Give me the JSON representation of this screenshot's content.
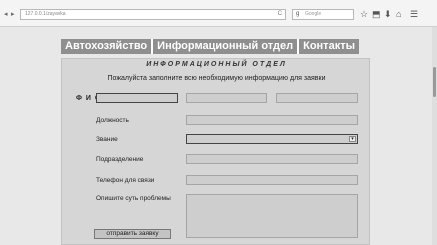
{
  "browser": {
    "nav_back": "◂",
    "nav_forward": "▸",
    "url": "127.0.0.1/zayavka",
    "reload_symbol": "C",
    "search_placeholder": "Google",
    "search_engine_symbol": "g",
    "toolbar_icons": [
      "☆",
      "⬒",
      "⬇",
      "⌂",
      "☰"
    ]
  },
  "nav": {
    "items": [
      {
        "label": "Автохозяйство"
      },
      {
        "label": "Информационный отдел"
      },
      {
        "label": "Контакты"
      }
    ]
  },
  "form": {
    "title": "ИНФОРМАЦИОННЫЙ ОТДЕЛ",
    "intro": "Пожалуйста заполните всю необходимую информацию для заявки",
    "fio_label": "Ф И О",
    "position_label": "Должность",
    "rank_label": "Звание",
    "select_arrow": "▾",
    "department_label": "Подразделение",
    "phone_label": "Телефон для связи",
    "problem_label": "Опишите суть проблемы",
    "submit_label": "отправить заявку"
  }
}
